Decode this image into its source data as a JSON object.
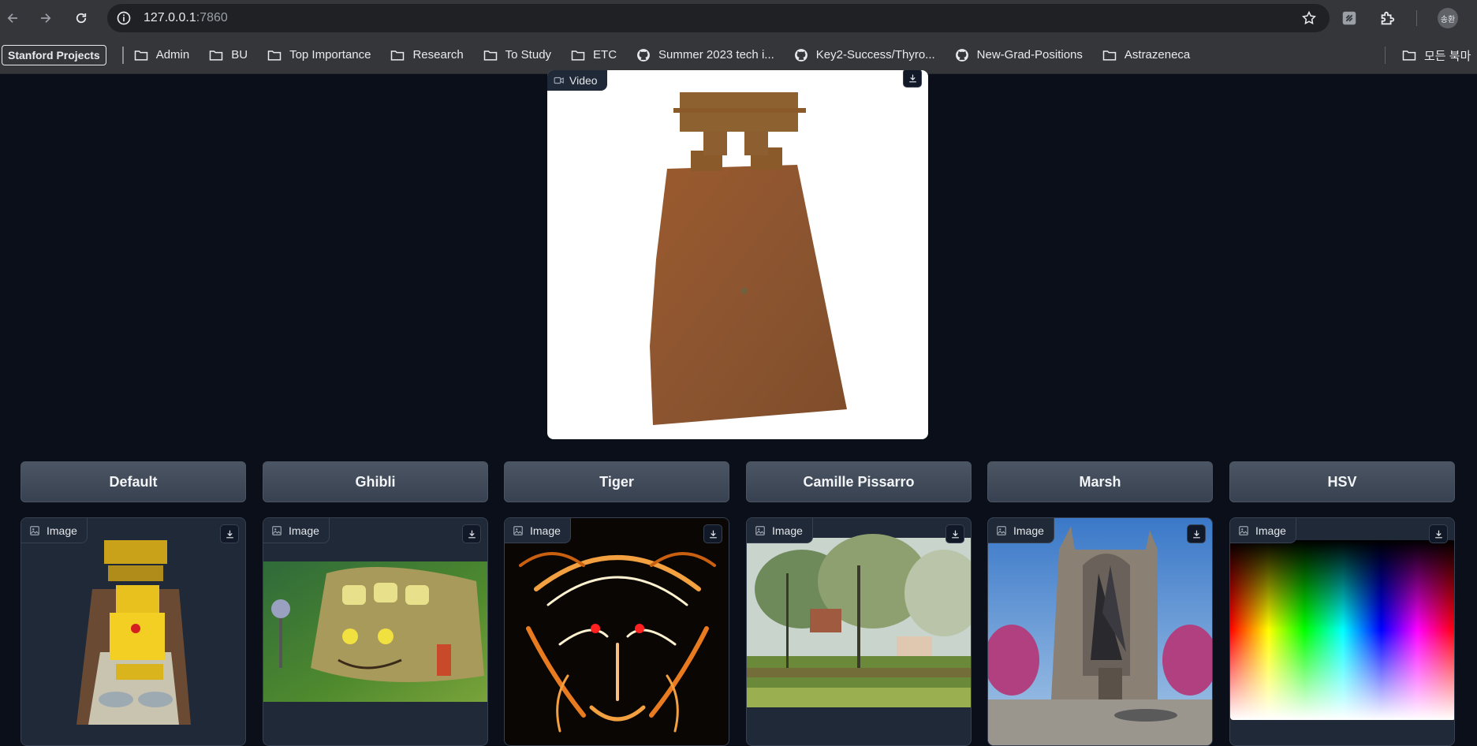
{
  "browser": {
    "url_host": "127.0.0.1",
    "url_port": ":7860",
    "avatar_text": "송환"
  },
  "bookmarks": {
    "first": "Stanford Projects",
    "items": [
      {
        "label": "Admin",
        "icon": "folder-icon"
      },
      {
        "label": "BU",
        "icon": "folder-icon"
      },
      {
        "label": "Top Importance",
        "icon": "folder-icon"
      },
      {
        "label": "Research",
        "icon": "folder-icon"
      },
      {
        "label": "To Study",
        "icon": "folder-icon"
      },
      {
        "label": "ETC",
        "icon": "folder-icon"
      },
      {
        "label": "Summer 2023 tech i...",
        "icon": "github-icon"
      },
      {
        "label": "Key2-Success/Thyro...",
        "icon": "github-icon"
      },
      {
        "label": "New-Grad-Positions",
        "icon": "github-icon"
      },
      {
        "label": "Astrazeneca",
        "icon": "folder-icon"
      }
    ],
    "all_bookmarks": "모든 북마"
  },
  "video": {
    "label": "Video"
  },
  "styles": {
    "buttons": [
      "Default",
      "Ghibli",
      "Tiger",
      "Camille Pissarro",
      "Marsh",
      "HSV"
    ]
  },
  "images": {
    "label": "Image"
  }
}
